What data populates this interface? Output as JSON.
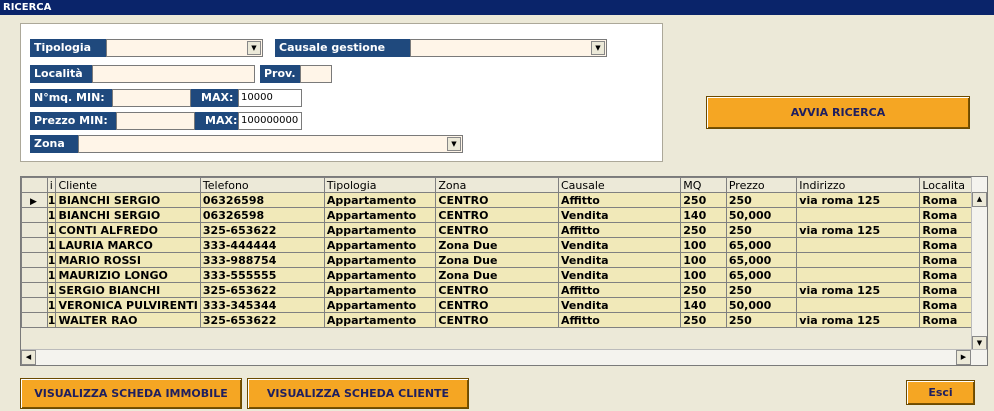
{
  "window": {
    "title": "RICERCA"
  },
  "filters": {
    "tipologia_label": "Tipologia",
    "tipologia_value": "",
    "causale_label": "Causale gestione",
    "causale_value": "",
    "localita_label": "Località",
    "localita_value": "",
    "prov_label": "Prov.",
    "prov_value": "",
    "mq_min_label": "N°mq. MIN:",
    "mq_min_value": "",
    "mq_max_label": "MAX:",
    "mq_max_value": "10000",
    "prezzo_min_label": "Prezzo  MIN:",
    "prezzo_min_value": "",
    "prezzo_max_label": "MAX:",
    "prezzo_max_value": "100000000",
    "zona_label": "Zona",
    "zona_value": ""
  },
  "buttons": {
    "avvia_ricerca": "AVVIA RICERCA",
    "scheda_immobile": "VISUALIZZA SCHEDA IMMOBILE",
    "scheda_cliente": "VISUALIZZA SCHEDA CLIENTE",
    "esci": "Esci"
  },
  "icons": {
    "dropdown": "chevron-down-icon",
    "row_pointer": "triangle-right-icon",
    "scroll_up": "arrow-up-icon",
    "scroll_down": "arrow-down-icon",
    "scroll_left": "arrow-left-icon",
    "scroll_right": "arrow-right-icon"
  },
  "colors": {
    "label_bg": "#1f497d",
    "button_bg": "#f5a623",
    "row_bg": "#f1e9b9",
    "title_bg": "#0a246a"
  },
  "grid": {
    "columns": [
      "",
      "i",
      "Cliente",
      "Telefono",
      "Tipologia",
      "Zona",
      "Causale",
      "MQ",
      "Prezzo",
      "Indirizzo",
      "Localita"
    ],
    "rows": [
      [
        "1",
        "BIANCHI SERGIO",
        "06326598",
        "Appartamento",
        "CENTRO",
        "Affitto",
        "250",
        "250",
        "via roma 125",
        "Roma"
      ],
      [
        "1",
        "BIANCHI SERGIO",
        "06326598",
        "Appartamento",
        "CENTRO",
        "Vendita",
        "140",
        "50,000",
        "",
        "Roma"
      ],
      [
        "1",
        "CONTI ALFREDO",
        "325-653622",
        "Appartamento",
        "CENTRO",
        "Affitto",
        "250",
        "250",
        "via roma 125",
        "Roma"
      ],
      [
        "1",
        "LAURIA MARCO",
        "333-444444",
        "Appartamento",
        "Zona Due",
        "Vendita",
        "100",
        "65,000",
        "",
        "Roma"
      ],
      [
        "1",
        "MARIO ROSSI",
        "333-988754",
        "Appartamento",
        "Zona Due",
        "Vendita",
        "100",
        "65,000",
        "",
        "Roma"
      ],
      [
        "1",
        "MAURIZIO LONGO",
        "333-555555",
        "Appartamento",
        "Zona Due",
        "Vendita",
        "100",
        "65,000",
        "",
        "Roma"
      ],
      [
        "1",
        "SERGIO BIANCHI",
        "325-653622",
        "Appartamento",
        "CENTRO",
        "Affitto",
        "250",
        "250",
        "via roma 125",
        "Roma"
      ],
      [
        "1",
        "VERONICA PULVIRENTI",
        "333-345344",
        "Appartamento",
        "CENTRO",
        "Vendita",
        "140",
        "50,000",
        "",
        "Roma"
      ],
      [
        "1",
        "WALTER RAO",
        "325-653622",
        "Appartamento",
        "CENTRO",
        "Affitto",
        "250",
        "250",
        "via roma 125",
        "Roma"
      ]
    ]
  }
}
